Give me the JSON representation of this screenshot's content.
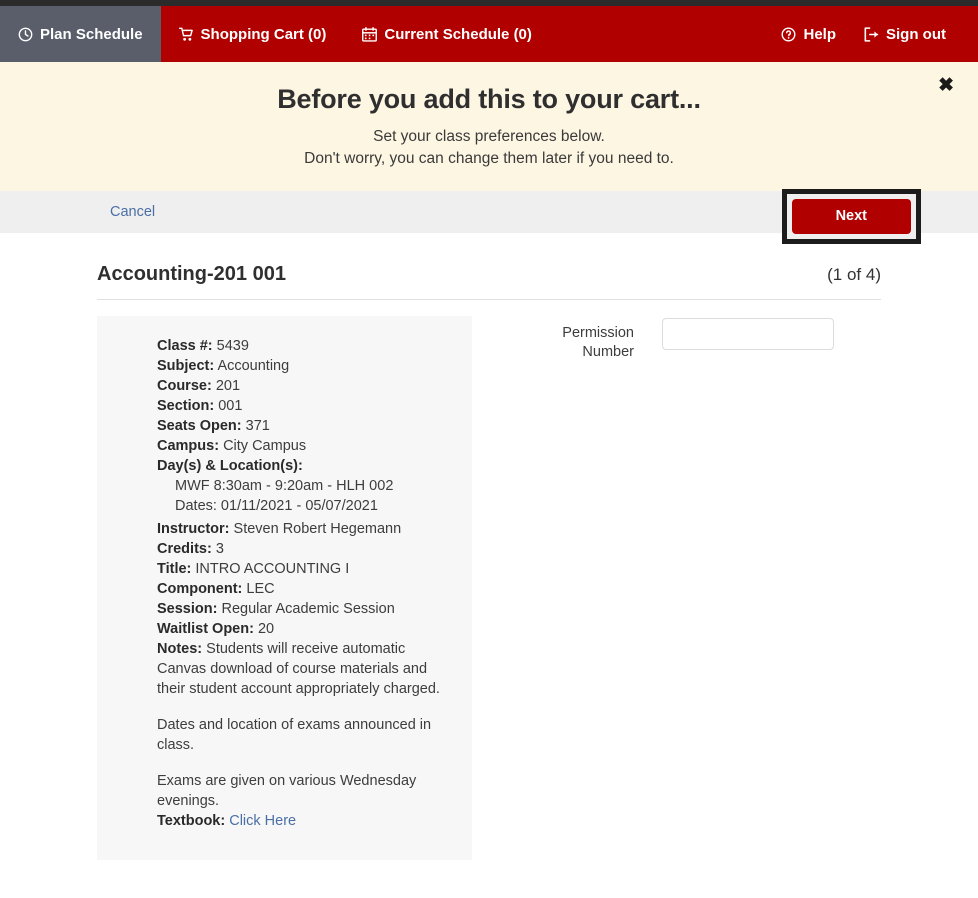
{
  "navbar": {
    "brand_color": "#b00000",
    "active_tab_color": "#5a5e6b",
    "left_items": [
      {
        "label": "Plan Schedule",
        "icon": "clock-icon",
        "active": true
      },
      {
        "label": "Shopping Cart (0)",
        "icon": "shopping-cart-icon",
        "active": false
      },
      {
        "label": "Current Schedule (0)",
        "icon": "calendar-icon",
        "active": false
      }
    ],
    "right_items": [
      {
        "label": "Help",
        "icon": "question-circle-icon"
      },
      {
        "label": "Sign out",
        "icon": "sign-out-icon"
      }
    ]
  },
  "banner": {
    "background": "#fdf6e3",
    "title": "Before you add this to your cart...",
    "subtitle_line1": "Set your class preferences below.",
    "subtitle_line2": "Don't worry, you can change them later if you need to.",
    "close_label": "✖"
  },
  "action_bar": {
    "cancel_label": "Cancel",
    "next_label": "Next",
    "next_highlighted": true,
    "next_color": "#b00000"
  },
  "course": {
    "title": "Accounting-201 001",
    "counter": "(1 of 4)",
    "details": [
      {
        "label": "Class #:",
        "value": "5439"
      },
      {
        "label": "Subject:",
        "value": "Accounting"
      },
      {
        "label": "Course:",
        "value": "201"
      },
      {
        "label": "Section:",
        "value": "001"
      },
      {
        "label": "Seats Open:",
        "value": "371"
      },
      {
        "label": "Campus:",
        "value": "City Campus"
      }
    ],
    "days_locations_label": "Day(s) & Location(s):",
    "meeting_time": "MWF 8:30am - 9:20am - HLH 002",
    "meeting_dates": "Dates: 01/11/2021 - 05/07/2021",
    "details2": [
      {
        "label": "Instructor:",
        "value": "Steven Robert Hegemann"
      },
      {
        "label": "Credits:",
        "value": "3"
      },
      {
        "label": "Title:",
        "value": "INTRO ACCOUNTING I"
      },
      {
        "label": "Component:",
        "value": "LEC"
      },
      {
        "label": "Session:",
        "value": "Regular Academic Session"
      },
      {
        "label": "Waitlist Open:",
        "value": "20"
      }
    ],
    "notes_label": "Notes:",
    "notes_text": "Students will receive automatic Canvas download of course materials and their student account appropriately charged.",
    "notes_para2": "Dates and location of exams announced in class.",
    "notes_para3": "Exams are given on various Wednesday evenings.",
    "textbook_label": "Textbook:",
    "textbook_link": "Click Here"
  },
  "permission": {
    "label_line1": "Permission",
    "label_line2": "Number",
    "value": "",
    "placeholder": ""
  }
}
